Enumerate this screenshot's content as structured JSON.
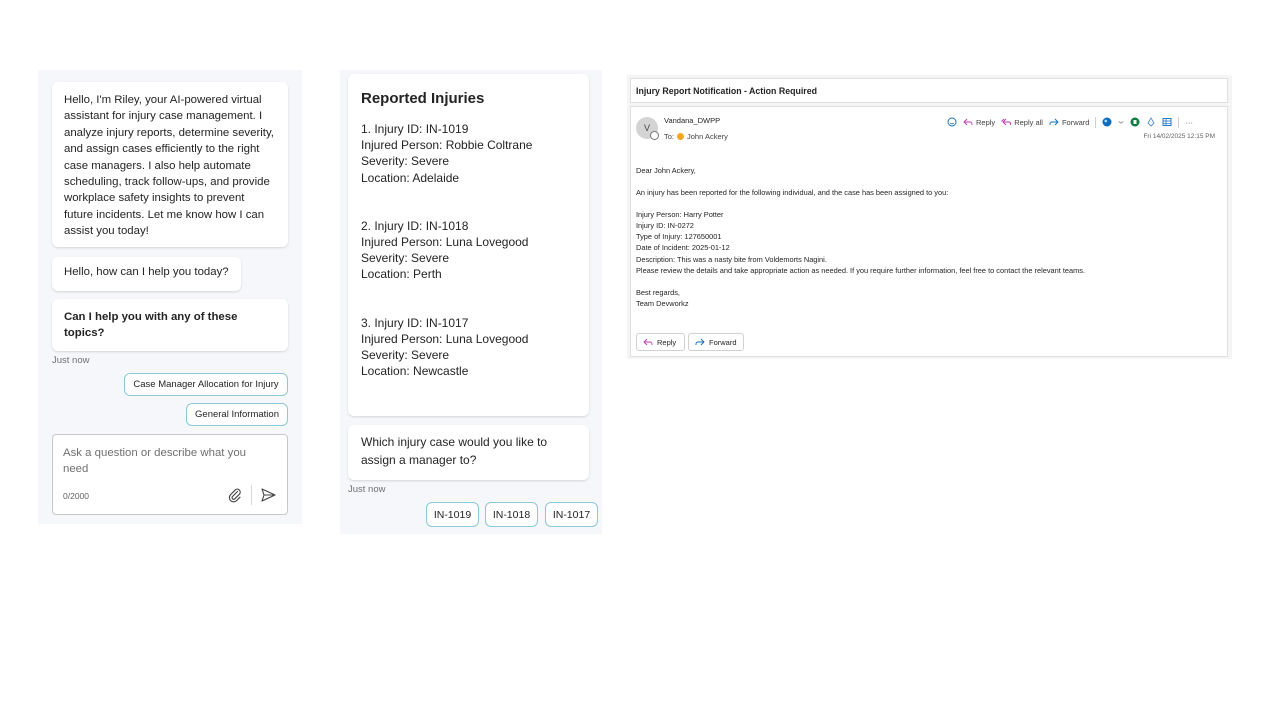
{
  "chat": {
    "intro_message": "Hello, I'm Riley, your AI-powered virtual assistant for injury case management. I analyze injury reports, determine severity, and assign cases efficiently to the right case managers. I also help automate scheduling, track follow-ups, and provide workplace safety insights to prevent future incidents. Let me know how I can assist you today!",
    "greeting": "Hello, how can I help you today?",
    "topics_prompt": "Can I help you with any of these topics?",
    "timestamp": "Just now",
    "suggestions": [
      "Case Manager Allocation for Injury",
      "General Information"
    ],
    "input": {
      "placeholder": "Ask a question or describe what you need",
      "counter": "0/2000",
      "attach_icon": "paperclip-icon",
      "send_icon": "send-icon"
    }
  },
  "injuries": {
    "title": "Reported Injuries",
    "items": [
      {
        "id_line": "1. Injury ID: IN-1019",
        "person_line": "Injured Person: Robbie Coltrane",
        "severity_line": "Severity: Severe",
        "location_line": "Location: Adelaide"
      },
      {
        "id_line": "2. Injury ID: IN-1018",
        "person_line": "Injured Person: Luna Lovegood",
        "severity_line": "Severity: Severe",
        "location_line": "Location: Perth"
      },
      {
        "id_line": "3. Injury ID: IN-1017",
        "person_line": "Injured Person: Luna Lovegood",
        "severity_line": "Severity: Severe",
        "location_line": "Location: Newcastle"
      }
    ],
    "question": "Which injury case would you like to assign a manager to?",
    "timestamp": "Just now",
    "options": [
      "IN-1019",
      "IN-1018",
      "IN-1017"
    ]
  },
  "email": {
    "subject": "Injury Report Notification - Action Required",
    "avatar_initial": "V",
    "sender": "Vandana_DWPP",
    "to_label": "To:",
    "recipient": "John Ackery",
    "date": "Fri 14/02/2025 12:15 PM",
    "toolbar": {
      "reply": "Reply",
      "reply_all": "Reply all",
      "forward": "Forward",
      "more": "···"
    },
    "greeting": "Dear John Ackery,",
    "intro": "An injury has been reported for the following individual, and the case has been assigned to you:",
    "details": [
      "Injury Person: Harry Potter",
      "Injury ID: IN-0272",
      "Type of Injury: 127650001",
      "Date of Incident: 2025-01-12",
      "Description: This was a nasty bite from Voldemorts Nagini.",
      "Please review the details and take appropriate action as needed. If you require further information, feel free to contact the relevant teams."
    ],
    "closing": "Best regards,",
    "signature": "Team Devworkz",
    "buttons": {
      "reply": "Reply",
      "forward": "Forward"
    },
    "colors": {
      "presence": "#f7a823",
      "reply_arrow": "#c239b3",
      "forward_arrow": "#0f6cbd"
    }
  }
}
